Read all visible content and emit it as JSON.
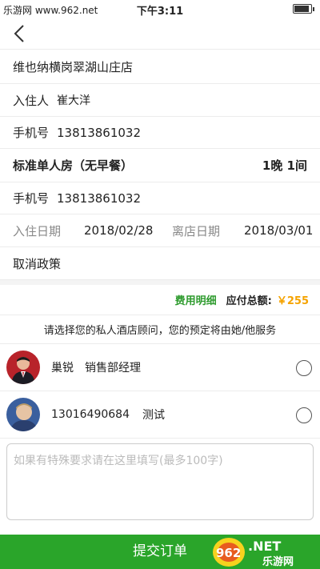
{
  "status_bar": {
    "left": "乐游网 www.962.net",
    "time": "下午3:11"
  },
  "hotel_name": "维也纳横岗翠湖山庄店",
  "guest": {
    "label": "入住人",
    "name": "崔大洋"
  },
  "phone1": {
    "label": "手机号",
    "value": "13813861032"
  },
  "room": {
    "name": "标准单人房（无早餐）",
    "qty": "1晚 1间"
  },
  "phone2": {
    "label": "手机号",
    "value": "13813861032"
  },
  "dates": {
    "checkin_label": "入住日期",
    "checkin": "2018/02/28",
    "checkout_label": "离店日期",
    "checkout": "2018/03/01"
  },
  "cancel_policy": "取消政策",
  "cost": {
    "detail_link": "费用明细",
    "total_label": "应付总额:",
    "total": "￥255"
  },
  "advisor_prompt": "请选择您的私人酒店顾问，您的预定将由她/他服务",
  "advisors": [
    {
      "name": "巢锐",
      "title": "销售部经理"
    },
    {
      "name": "13016490684",
      "title": "测试"
    }
  ],
  "special_request": {
    "placeholder": "如果有特殊要求请在这里填写(最多100字)"
  },
  "submit_label": "提交订单",
  "watermark": "962.NET 乐游网",
  "colors": {
    "accent_green": "#2aa52a",
    "price_orange": "#f5a300"
  }
}
